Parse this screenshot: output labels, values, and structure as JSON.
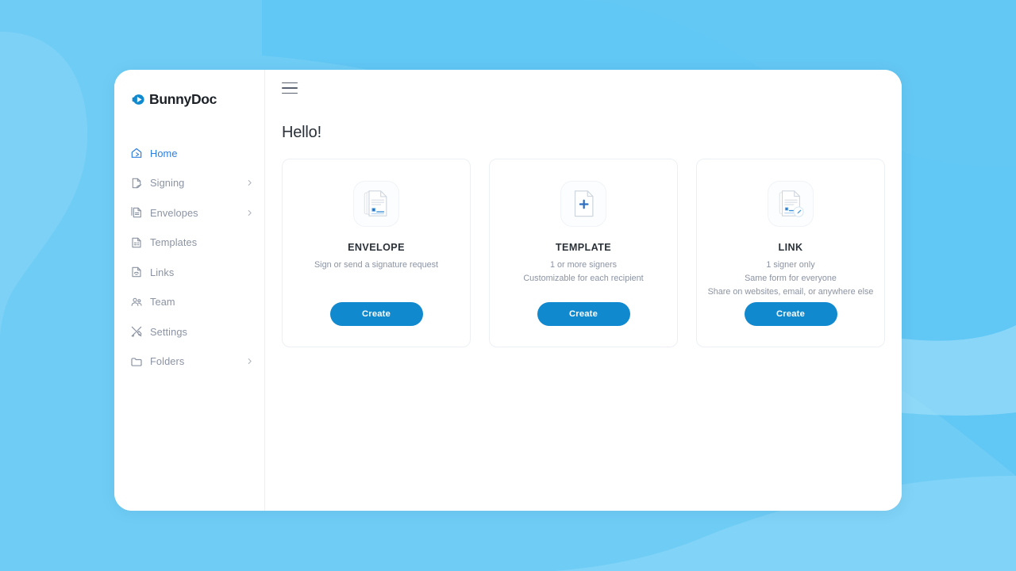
{
  "brand": {
    "name": "BunnyDoc",
    "logo_icon": "bunnydoc-logo-icon",
    "accent_color": "#1089cf"
  },
  "background": {
    "base_color": "#6fcdf5",
    "blob_light_color": "#8fd8f8",
    "blob_dark_color": "#5fc6f3"
  },
  "sidebar": {
    "items": [
      {
        "label": "Home",
        "icon": "home-icon",
        "active": true,
        "has_chevron": false
      },
      {
        "label": "Signing",
        "icon": "signing-icon",
        "active": false,
        "has_chevron": true
      },
      {
        "label": "Envelopes",
        "icon": "envelopes-icon",
        "active": false,
        "has_chevron": true
      },
      {
        "label": "Templates",
        "icon": "templates-icon",
        "active": false,
        "has_chevron": false
      },
      {
        "label": "Links",
        "icon": "links-icon",
        "active": false,
        "has_chevron": false
      },
      {
        "label": "Team",
        "icon": "team-icon",
        "active": false,
        "has_chevron": false
      },
      {
        "label": "Settings",
        "icon": "settings-icon",
        "active": false,
        "has_chevron": false
      },
      {
        "label": "Folders",
        "icon": "folders-icon",
        "active": false,
        "has_chevron": true
      }
    ]
  },
  "topbar": {
    "menu_icon": "hamburger-menu-icon"
  },
  "main": {
    "greeting": "Hello!",
    "cards": [
      {
        "title": "ENVELOPE",
        "icon": "document-signature-icon",
        "description_lines": [
          "Sign or send a signature request"
        ],
        "button_label": "Create"
      },
      {
        "title": "TEMPLATE",
        "icon": "document-plus-icon",
        "description_lines": [
          "1 or more signers",
          "Customizable for each recipient"
        ],
        "button_label": "Create"
      },
      {
        "title": "LINK",
        "icon": "document-pen-badge-icon",
        "description_lines": [
          "1 signer only",
          "Same form for everyone",
          "Share on websites, email, or anywhere else"
        ],
        "button_label": "Create"
      }
    ]
  }
}
